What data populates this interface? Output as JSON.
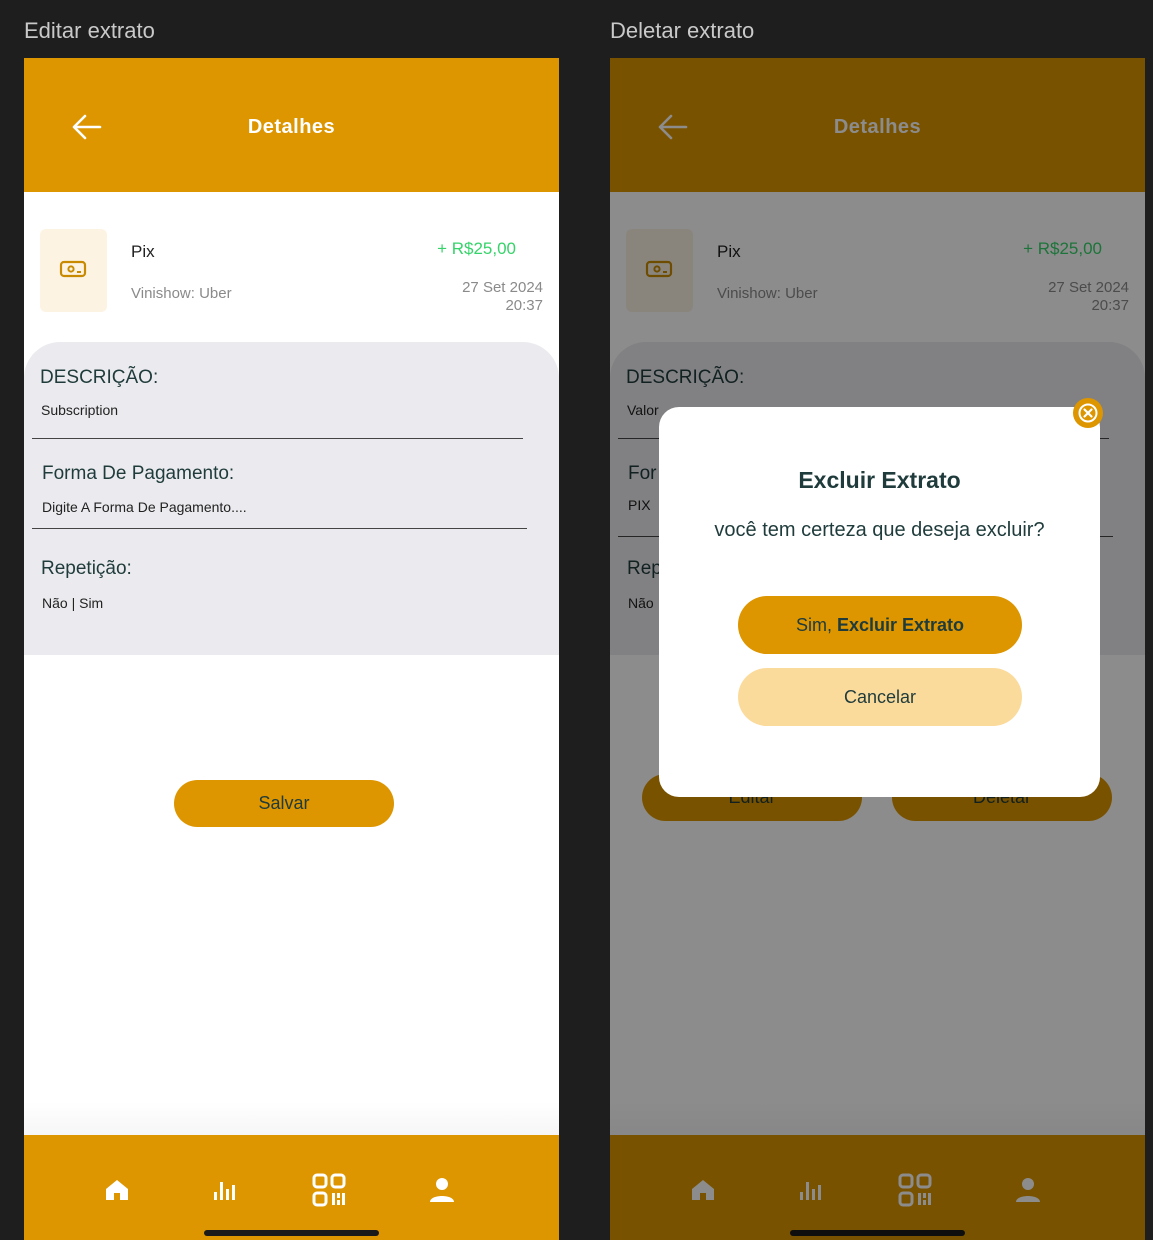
{
  "frames": {
    "left_label": "Editar extrato",
    "right_label": "Deletar extrato"
  },
  "header": {
    "title": "Detalhes"
  },
  "transaction": {
    "name": "Pix",
    "subtitle": "Vinishow: Uber",
    "amount": "+ R$25,00",
    "date": "27 Set 2024",
    "time": "20:37"
  },
  "edit_form": {
    "description_label": "DESCRIÇÃO:",
    "description_value": "Subscription",
    "payment_label": "Forma De Pagamento:",
    "payment_placeholder": "Digite A Forma De Pagamento....",
    "repeat_label": "Repetição:",
    "repeat_no": "Não",
    "repeat_sep": "|",
    "repeat_yes": "Sim",
    "save_label": "Salvar"
  },
  "delete_view": {
    "description_label": "DESCRIÇÃO:",
    "description_value_visible": "Valor",
    "payment_label_visible": "For",
    "payment_value_visible": "PIX",
    "repeat_label_visible": "Rep",
    "repeat_value_visible": "Não",
    "edit_label": "Editar",
    "delete_label": "Deletar"
  },
  "modal": {
    "title": "Excluir Extrato",
    "message": "você tem certeza que deseja excluir?",
    "confirm_prefix": "Sim, ",
    "confirm_bold": "Excluir Extrato",
    "cancel_label": "Cancelar"
  },
  "tabs": [
    {
      "icon": "home-icon"
    },
    {
      "icon": "bar-chart-icon"
    },
    {
      "icon": "qr-code-icon"
    },
    {
      "icon": "user-icon"
    }
  ],
  "colors": {
    "accent": "#dd9500",
    "accent_light": "#fbdb9c",
    "text_dark": "#1f3b3b",
    "positive": "#36d36a"
  }
}
